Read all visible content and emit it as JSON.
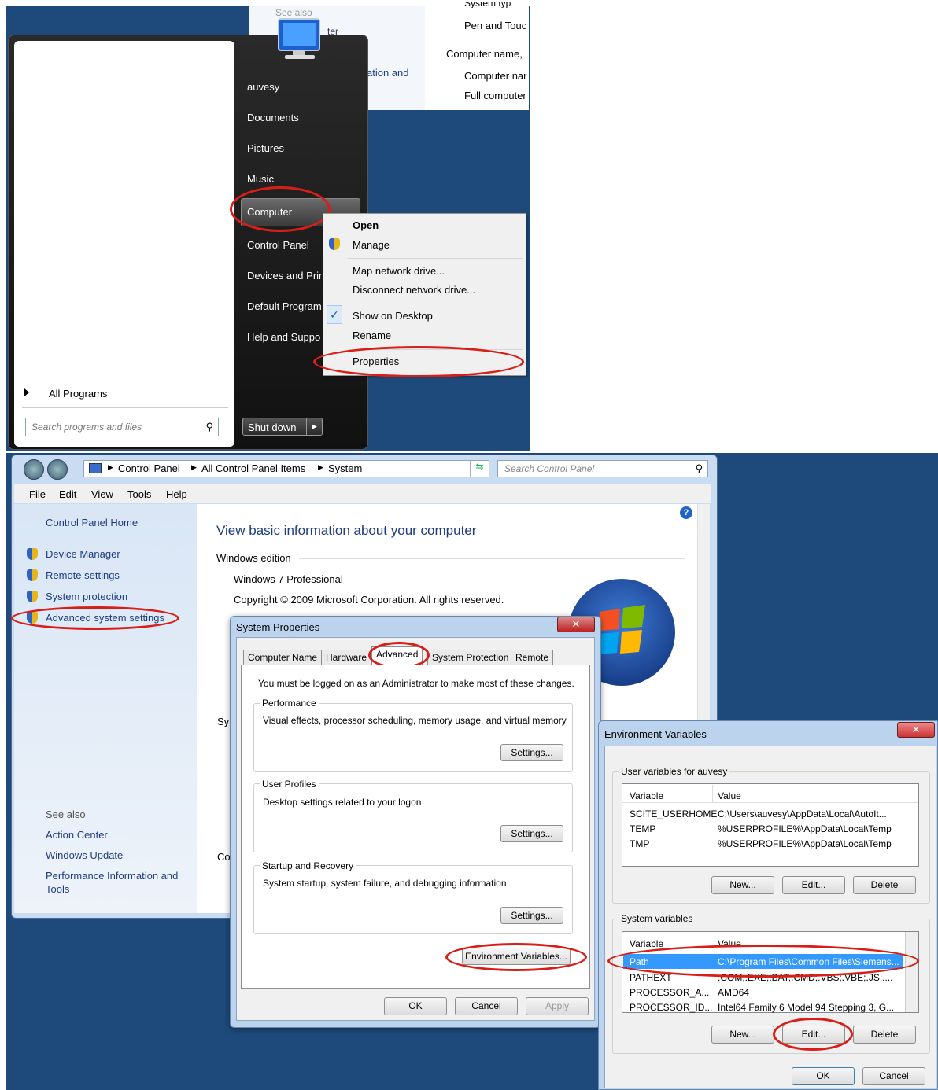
{
  "start_menu": {
    "items": [
      "auvesy",
      "Documents",
      "Pictures",
      "Music",
      "Computer",
      "Control Panel",
      "Devices and Prin",
      "Default Program",
      "Help and Suppo"
    ],
    "all_programs": "All Programs",
    "search_placeholder": "Search programs and files",
    "shutdown": "Shut down"
  },
  "bg_window": {
    "see_also": "See also",
    "cut_ter": "ter",
    "cut_ation": "ation and",
    "pen_touch": "Pen and Touc",
    "comp_name": "Computer name,",
    "comp_nam2": "Computer nar",
    "full_comp": "Full computer",
    "system_typ": "System typ"
  },
  "context_menu": {
    "open": "Open",
    "manage": "Manage",
    "map": "Map network drive...",
    "disconnect": "Disconnect network drive...",
    "show": "Show on Desktop",
    "rename": "Rename",
    "properties": "Properties"
  },
  "explorer": {
    "breadcrumb": [
      "Control Panel",
      "All Control Panel Items",
      "System"
    ],
    "search_placeholder": "Search Control Panel",
    "menu": [
      "File",
      "Edit",
      "View",
      "Tools",
      "Help"
    ],
    "sidebar": {
      "home": "Control Panel Home",
      "links": [
        "Device Manager",
        "Remote settings",
        "System protection",
        "Advanced system settings"
      ],
      "see_also": "See also",
      "see_also_links": [
        "Action Center",
        "Windows Update",
        "Performance Information and Tools"
      ]
    },
    "main": {
      "title": "View basic information about your computer",
      "edition_header": "Windows edition",
      "edition": "Windows 7 Professional",
      "copyright": "Copyright © 2009 Microsoft Corporation.  All rights reserved.",
      "cut_sy": "Sy",
      "cut_co": "Co"
    }
  },
  "system_properties": {
    "title": "System Properties",
    "tabs": [
      "Computer Name",
      "Hardware",
      "Advanced",
      "System Protection",
      "Remote"
    ],
    "admin_note": "You must be logged on as an Administrator to make most of these changes.",
    "performance": {
      "label": "Performance",
      "desc": "Visual effects, processor scheduling, memory usage, and virtual memory",
      "button": "Settings..."
    },
    "profiles": {
      "label": "User Profiles",
      "desc": "Desktop settings related to your logon",
      "button": "Settings..."
    },
    "startup": {
      "label": "Startup and Recovery",
      "desc": "System startup, system failure, and debugging information",
      "button": "Settings..."
    },
    "env_button": "Environment Variables...",
    "ok": "OK",
    "cancel": "Cancel",
    "apply": "Apply"
  },
  "env_vars": {
    "title": "Environment Variables",
    "user_label": "User variables for auvesy",
    "columns": [
      "Variable",
      "Value"
    ],
    "user_rows": [
      [
        "SCITE_USERHOME",
        "C:\\Users\\auvesy\\AppData\\Local\\AutoIt..."
      ],
      [
        "TEMP",
        "%USERPROFILE%\\AppData\\Local\\Temp"
      ],
      [
        "TMP",
        "%USERPROFILE%\\AppData\\Local\\Temp"
      ]
    ],
    "system_label": "System variables",
    "system_rows": [
      [
        "Path",
        "C:\\Program Files\\Common Files\\Siemens..."
      ],
      [
        "PATHEXT",
        ".COM;.EXE;.BAT;.CMD;.VBS;.VBE;.JS;...."
      ],
      [
        "PROCESSOR_A...",
        "AMD64"
      ],
      [
        "PROCESSOR_ID...",
        "Intel64 Family 6 Model 94 Stepping 3, G..."
      ]
    ],
    "new": "New...",
    "edit": "Edit...",
    "delete": "Delete",
    "ok": "OK",
    "cancel": "Cancel"
  }
}
